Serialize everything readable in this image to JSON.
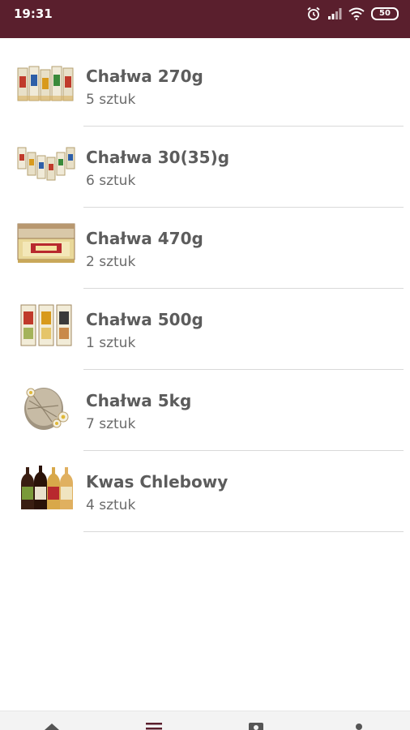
{
  "status_bar": {
    "time": "19:31",
    "battery": "50",
    "icons": [
      "alarm-icon",
      "signal-icon",
      "wifi-icon",
      "battery-icon"
    ],
    "background": "#5a1f2d"
  },
  "list": {
    "items": [
      {
        "title": "Chałwa 270g",
        "subtitle": "5 sztuk",
        "icon": "halva-bars-image"
      },
      {
        "title": "Chałwa 30(35)g",
        "subtitle": "6 sztuk",
        "icon": "halva-small-bars-image"
      },
      {
        "title": "Chałwa 470g",
        "subtitle": "2 sztuk",
        "icon": "halva-box-image"
      },
      {
        "title": "Chałwa 500g",
        "subtitle": "1 sztuk",
        "icon": "halva-packs-image"
      },
      {
        "title": "Chałwa 5kg",
        "subtitle": "7 sztuk",
        "icon": "halva-block-image"
      },
      {
        "title": "Kwas Chlebowy",
        "subtitle": "4 sztuk",
        "icon": "kvass-bottles-image"
      }
    ]
  },
  "bottom_nav": {
    "items": [
      "home-icon",
      "menu-icon",
      "account-icon",
      "person-icon"
    ]
  },
  "colors": {
    "title": "#5c5c5c",
    "subtitle": "#6a6a6a",
    "divider": "#d9d9d9"
  }
}
